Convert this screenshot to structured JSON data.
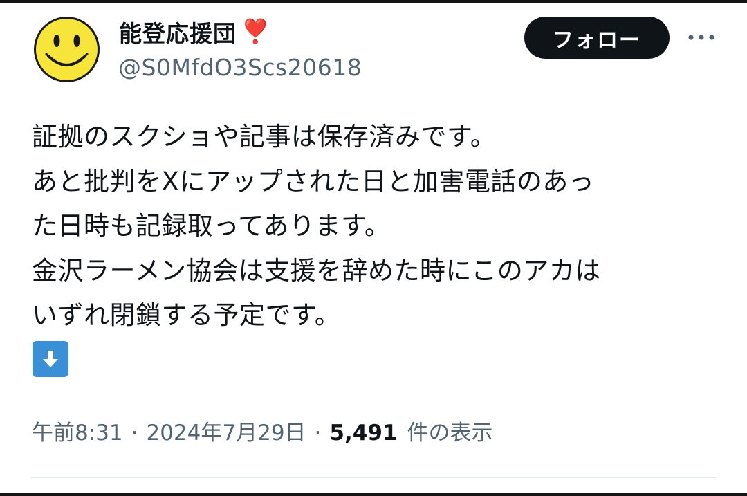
{
  "author": {
    "display_name": "能登応援団",
    "heart_emoji": "❣️",
    "handle": "@S0MfdO3Scs20618",
    "avatar": "smiley-face-icon"
  },
  "header": {
    "follow_label": "フォロー",
    "more_icon": "more-dots-icon"
  },
  "tweet": {
    "lines": [
      "証拠のスクショや記事は保存済みです。",
      "あと批判をXにアップされた日と加害電話のあっ",
      "た日時も記録取ってあります。",
      "金沢ラーメン協会は支援を辞めた時にこのアカは",
      "いずれ閉鎖する予定です。"
    ],
    "emoji": "down-arrow-icon"
  },
  "meta": {
    "time": "午前8:31",
    "separator": "·",
    "date": "2024年7月29日",
    "views_count": "5,491",
    "views_label": "件の表示"
  },
  "colors": {
    "text_primary": "#0f1419",
    "text_secondary": "#536471",
    "follow_bg": "#0f1419",
    "heart": "#e0245e",
    "emoji_blue": "#3b8fd6",
    "avatar_yellow": "#f7e53b"
  }
}
